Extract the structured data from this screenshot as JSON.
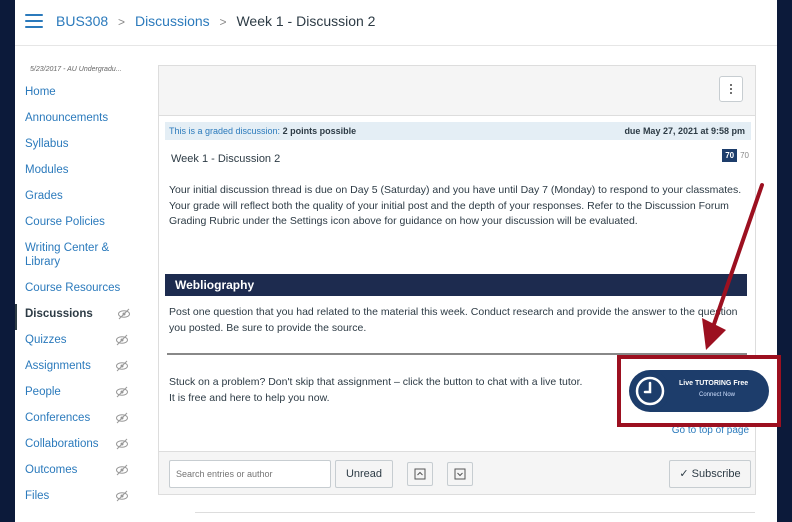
{
  "breadcrumb": {
    "course": "BUS308",
    "section": "Discussions",
    "current": "Week 1 - Discussion 2"
  },
  "sidebar": {
    "term": "5/23/2017 - AU Undergradu...",
    "items": [
      {
        "label": "Home"
      },
      {
        "label": "Announcements"
      },
      {
        "label": "Syllabus"
      },
      {
        "label": "Modules"
      },
      {
        "label": "Grades"
      },
      {
        "label": "Course Policies"
      },
      {
        "label": "Writing Center & Library"
      },
      {
        "label": "Course Resources"
      },
      {
        "label": "Discussions"
      },
      {
        "label": "Quizzes"
      },
      {
        "label": "Assignments"
      },
      {
        "label": "People"
      },
      {
        "label": "Conferences"
      },
      {
        "label": "Collaborations"
      },
      {
        "label": "Outcomes"
      },
      {
        "label": "Files"
      }
    ]
  },
  "discussion": {
    "graded_label": "This is a graded discussion:",
    "points": "2 points possible",
    "due": "due May 27, 2021 at 9:58 pm",
    "title": "Week 1 - Discussion 2",
    "score": "70",
    "score_total": "70",
    "body": "Your initial discussion thread is due on Day 5 (Saturday) and you have until Day 7 (Monday) to respond to your classmates. Your grade will reflect both the quality of your initial post and the depth of your responses. Refer to the Discussion Forum Grading Rubric under the Settings icon above for guidance on how your discussion will be evaluated.",
    "section_heading": "Webliography",
    "section_body": "Post one question that you had related to the material this week. Conduct research and provide the answer to the question you posted. Be sure to provide the source.",
    "help_line1": "Stuck on a problem? Don't skip that assignment – click the button to chat with a live tutor.",
    "help_line2": "It is free and here to help you now.",
    "goto_top": "Go to top of page"
  },
  "toolbar": {
    "search_placeholder": "Search entries or author",
    "unread": "Unread",
    "subscribe": "Subscribe"
  },
  "tutoring": {
    "line1": "Live TUTORING Free",
    "line2": "Connect Now"
  },
  "colors": {
    "link": "#2b7abc",
    "navy": "#1d2b4f",
    "highlight_frame": "#9c1020"
  }
}
